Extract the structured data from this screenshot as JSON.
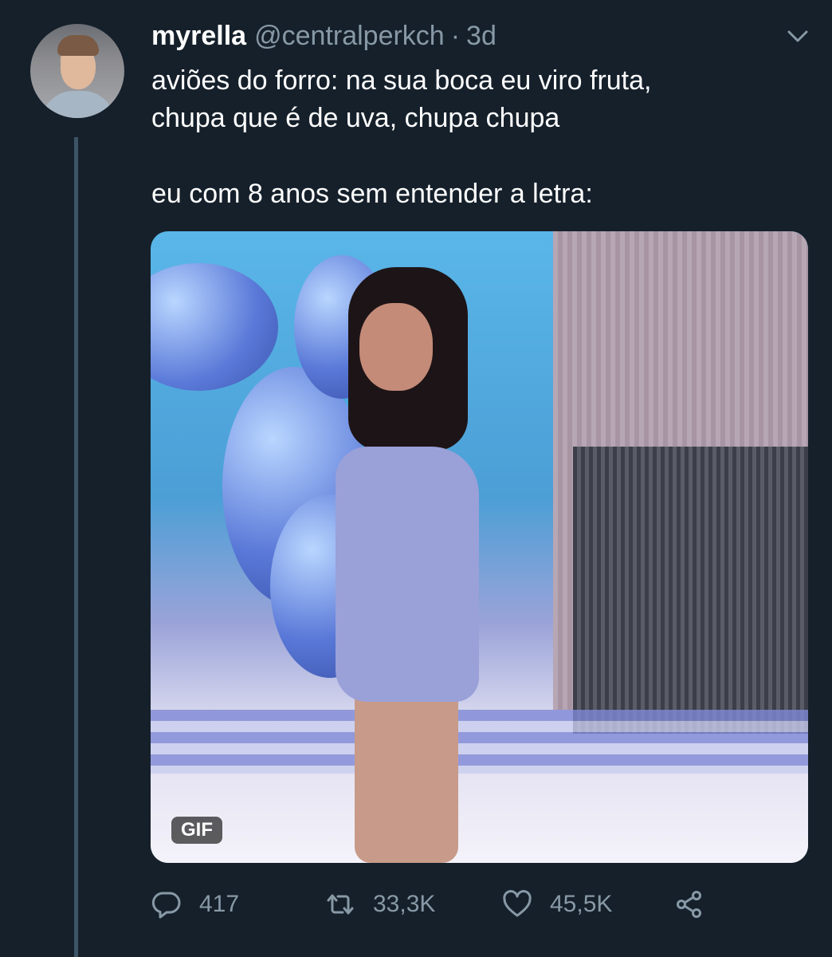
{
  "tweet": {
    "display_name": "myrella",
    "handle": "@centralperkch",
    "separator": "·",
    "time": "3d",
    "text_lines": [
      "aviões do forro: na sua boca eu viro fruta,",
      "chupa que é de uva, chupa chupa",
      "eu com 8 anos sem entender a letra:"
    ],
    "media_badge": "GIF"
  },
  "actions": {
    "replies": "417",
    "retweets": "33,3K",
    "likes": "45,5K"
  },
  "icons": {
    "more": "chevron-down-icon",
    "reply": "reply-icon",
    "retweet": "retweet-icon",
    "like": "heart-icon",
    "share": "share-icon"
  },
  "colors": {
    "background": "#15202b",
    "text": "#ffffff",
    "secondary": "#8899a6",
    "thread_line": "#3d5466"
  }
}
